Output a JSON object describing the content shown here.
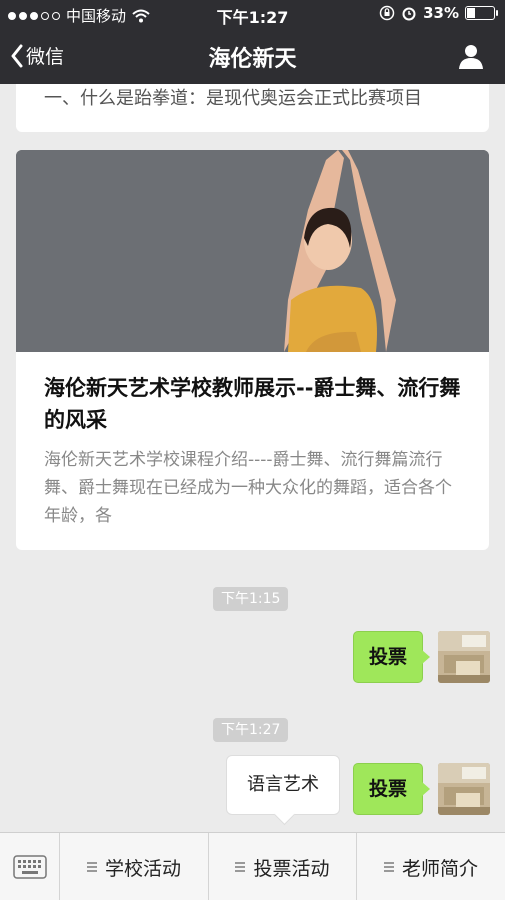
{
  "status": {
    "carrier": "中国移动",
    "time": "下午1:27",
    "battery_pct": "33%",
    "battery_level": 0.33,
    "signal_icon": "signal-dots-icon",
    "wifi_icon": "wifi-icon"
  },
  "nav": {
    "back_label": "微信",
    "title": "海伦新天",
    "profile_icon": "person-icon"
  },
  "messages": {
    "prev_article_snippet": "一、什么是跆拳道：是现代奥运会正式比赛项目",
    "article": {
      "title": "海伦新天艺术学校教师展示--爵士舞、流行舞的风采",
      "description": "海伦新天艺术学校课程介绍----爵士舞、流行舞篇流行舞、爵士舞现在已经成为一种大众化的舞蹈，适合各个年龄，各"
    },
    "time_1": "下午1:15",
    "bubble_1": "投票",
    "time_2": "下午1:27",
    "bubble_2": "投票"
  },
  "popup": {
    "label": "语言艺术"
  },
  "menu": {
    "keyboard_icon": "keyboard-icon",
    "items": [
      {
        "label": "学校活动"
      },
      {
        "label": "投票活动"
      },
      {
        "label": "老师简介"
      }
    ]
  },
  "colors": {
    "bar_bg": "#2e2e32",
    "bubble_green": "#9fe75a",
    "chat_bg": "#ebebeb"
  }
}
